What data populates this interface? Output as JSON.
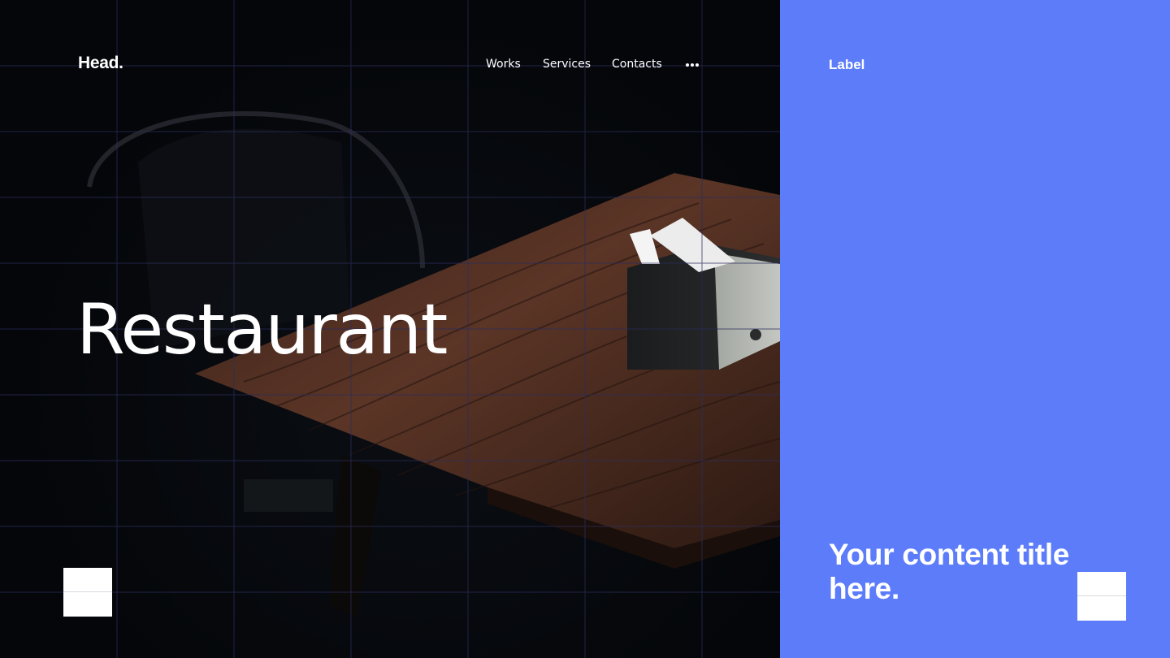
{
  "brand": {
    "name": "Head."
  },
  "nav": {
    "items": [
      {
        "label": "Works"
      },
      {
        "label": "Services"
      },
      {
        "label": "Contacts"
      }
    ],
    "more_icon": "more-horizontal-icon"
  },
  "hero": {
    "title": "Restaurant"
  },
  "side_panel": {
    "label": "Label",
    "title": "Your content title here.",
    "background_color": "#5c7cfa"
  },
  "colors": {
    "accent": "#5c7cfa",
    "dark_background": "#05080c",
    "text": "#ffffff"
  }
}
